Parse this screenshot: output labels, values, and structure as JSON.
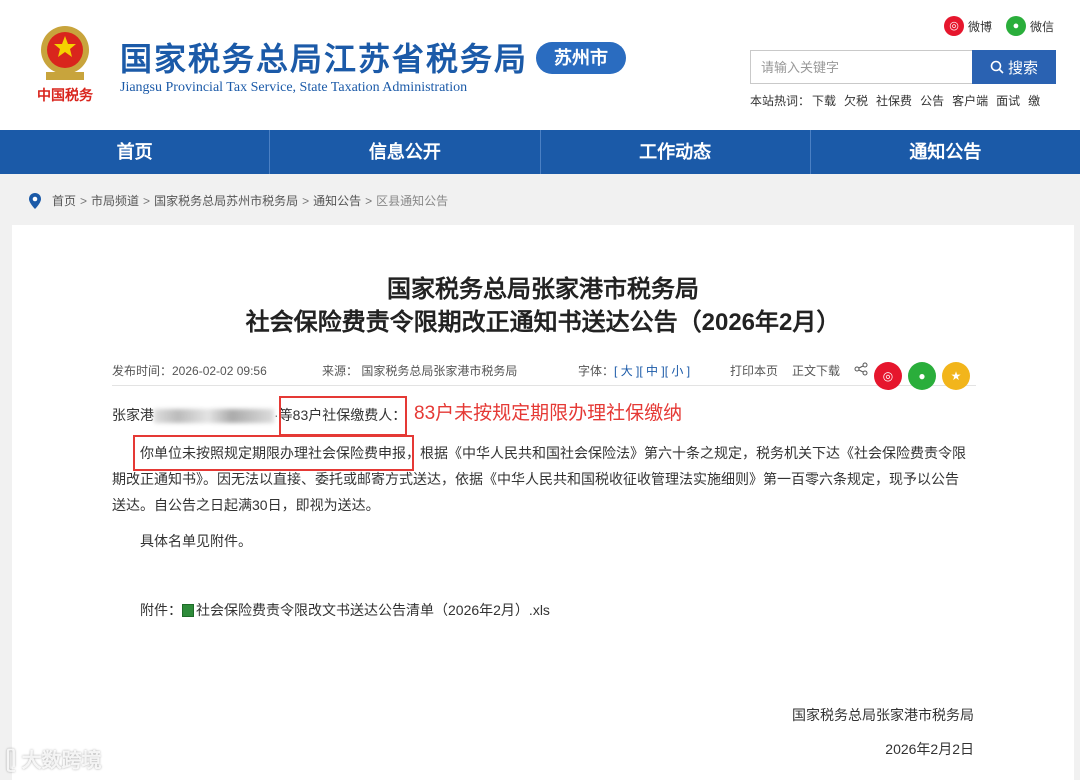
{
  "header": {
    "title": "国家税务总局江苏省税务局",
    "city": "苏州市",
    "subtitle": "Jiangsu Provincial Tax Service, State Taxation Administration",
    "emblem_text": "中国税务",
    "weibo": "微博",
    "wechat": "微信",
    "search_placeholder": "请输入关键字",
    "search_label": "搜索",
    "hotwords_label": "本站热词：",
    "hotwords": [
      "下载",
      "欠税",
      "社保费",
      "公告",
      "客户端",
      "面试",
      "缴"
    ]
  },
  "nav": [
    "首页",
    "信息公开",
    "工作动态",
    "通知公告"
  ],
  "breadcrumb": [
    "首页",
    "市局频道",
    "国家税务总局苏州市税务局",
    "通知公告",
    "区县通知公告"
  ],
  "article": {
    "title_line1": "国家税务总局张家港市税务局",
    "title_line2": "社会保险费责令限期改正通知书送达公告（2026年2月）",
    "publish_time": "发布时间：2026-02-02 09:56",
    "source": "来源：  国家税务总局张家港市税务局",
    "font_label": "字体：",
    "font_large": "大",
    "font_medium": "中",
    "font_small": "小",
    "print": "打印本页",
    "download": "正文下载",
    "addressee_prefix": "张家港",
    "addressee_suffix_a": "等",
    "addressee_suffix_b": "83户社保缴费人：",
    "annotation": "83户未按规定期限办理社保缴纳",
    "body_highlight": "你单位未按照规定期限办理社会保险费申报，",
    "body_rest_1": "根据《中华人民共和国社会保险法》第六十条之规定，税务机关下达《社会保险费责令限",
    "body_line_2": "期改正通知书》。因无法以直接、委托或邮寄方式送达，依据《中华人民共和国税收征收管理法实施细则》第一百零六条规定，现予以公告",
    "body_line_3": "送达。自公告之日起满30日，即视为送达。",
    "detail": "具体名单见附件。",
    "attachment_label": "附件：",
    "attachment_file": "社会保险费责令限改文书送达公告清单（2026年2月）.xls",
    "signature": "国家税务总局张家港市税务局",
    "date": "2026年2月2日"
  },
  "watermark": "大数跨境",
  "colors": {
    "brand_blue": "#1b5aa8",
    "highlight_red": "#e53935"
  }
}
